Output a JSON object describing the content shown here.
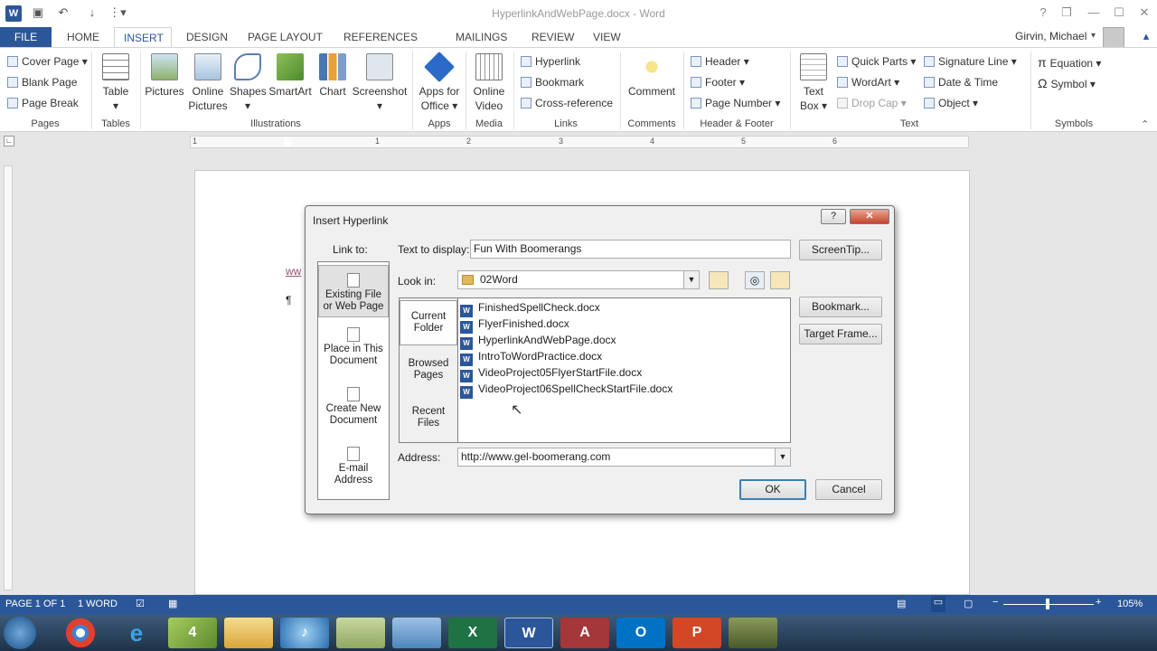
{
  "window": {
    "title": "HyperlinkAndWebPage.docx - Word"
  },
  "quick_access": {
    "icons": [
      "save-icon",
      "undo-icon",
      "redo-icon",
      "customize-icon"
    ]
  },
  "window_controls": {
    "help": "?",
    "restore": "❐",
    "minimize": "—",
    "maximize": "☐",
    "close": "✕"
  },
  "tabs": [
    "FILE",
    "HOME",
    "INSERT",
    "DESIGN",
    "PAGE LAYOUT",
    "REFERENCES",
    "MAILINGS",
    "REVIEW",
    "VIEW"
  ],
  "user": {
    "name": "Girvin, Michael"
  },
  "ribbon": {
    "pages": {
      "label": "Pages",
      "cover_page": "Cover Page",
      "blank_page": "Blank Page",
      "page_break": "Page Break"
    },
    "tables": {
      "label": "Tables",
      "table": "Table"
    },
    "illustrations": {
      "label": "Illustrations",
      "pictures": "Pictures",
      "online_pictures_1": "Online",
      "online_pictures_2": "Pictures",
      "shapes": "Shapes",
      "smartart": "SmartArt",
      "chart": "Chart",
      "screenshot": "Screenshot"
    },
    "apps": {
      "label": "Apps",
      "apps_for_office_1": "Apps for",
      "apps_for_office_2": "Office"
    },
    "media": {
      "label": "Media",
      "online_video_1": "Online",
      "online_video_2": "Video"
    },
    "links": {
      "label": "Links",
      "hyperlink": "Hyperlink",
      "bookmark": "Bookmark",
      "cross_reference": "Cross-reference"
    },
    "comments": {
      "label": "Comments",
      "comment": "Comment"
    },
    "header_footer": {
      "label": "Header & Footer",
      "header": "Header",
      "footer": "Footer",
      "page_number": "Page Number"
    },
    "text": {
      "label": "Text",
      "text_box_1": "Text",
      "text_box_2": "Box",
      "quick_parts": "Quick Parts",
      "wordart": "WordArt",
      "drop_cap": "Drop Cap",
      "signature_line": "Signature Line",
      "date_time": "Date & Time",
      "object": "Object"
    },
    "symbols": {
      "label": "Symbols",
      "equation": "Equation",
      "symbol": "Symbol"
    }
  },
  "ruler": {
    "numbers": [
      "1",
      "1",
      "2",
      "3",
      "4",
      "5",
      "6"
    ]
  },
  "document": {
    "partial_text": "ww",
    "pilcrow": "¶"
  },
  "dialog": {
    "title": "Insert Hyperlink",
    "help_btn": "?",
    "close_btn": "✕",
    "link_to_label": "Link to:",
    "link_to": [
      {
        "line1": "Existing File",
        "line2": "or Web Page"
      },
      {
        "line1": "Place in This",
        "line2": "Document"
      },
      {
        "line1": "Create New",
        "line2": "Document"
      },
      {
        "line1": "E-mail",
        "line2": "Address"
      }
    ],
    "text_to_display_label": "Text to display:",
    "text_to_display_value": "Fun With Boomerangs",
    "screentip_button": "ScreenTip...",
    "look_in_label": "Look in:",
    "look_in_value": "02Word",
    "subnav": [
      {
        "line1": "Current",
        "line2": "Folder"
      },
      {
        "line1": "Browsed",
        "line2": "Pages"
      },
      {
        "line1": "Recent",
        "line2": "Files"
      }
    ],
    "files": [
      "FinishedSpellCheck.docx",
      "FlyerFinished.docx",
      "HyperlinkAndWebPage.docx",
      "IntroToWordPractice.docx",
      "VideoProject05FlyerStartFile.docx",
      "VideoProject06SpellCheckStartFile.docx"
    ],
    "bookmark_button": "Bookmark...",
    "target_frame_button": "Target Frame...",
    "address_label": "Address:",
    "address_value": "http://www.gel-boomerang.com",
    "ok_button": "OK",
    "cancel_button": "Cancel"
  },
  "status": {
    "page": "PAGE 1 OF 1",
    "words": "1 WORD",
    "zoom": "105%"
  },
  "taskbar": {
    "apps": [
      "chrome",
      "ie",
      "app4",
      "explorer",
      "itunes",
      "app-green",
      "app-blue",
      "excel",
      "word",
      "access",
      "outlook",
      "powerpoint",
      "camtasia"
    ],
    "app4_label": "4"
  },
  "colors": {
    "accent": "#2b579a",
    "file_tab": "#2b579a",
    "status_bar": "#2b579a"
  }
}
